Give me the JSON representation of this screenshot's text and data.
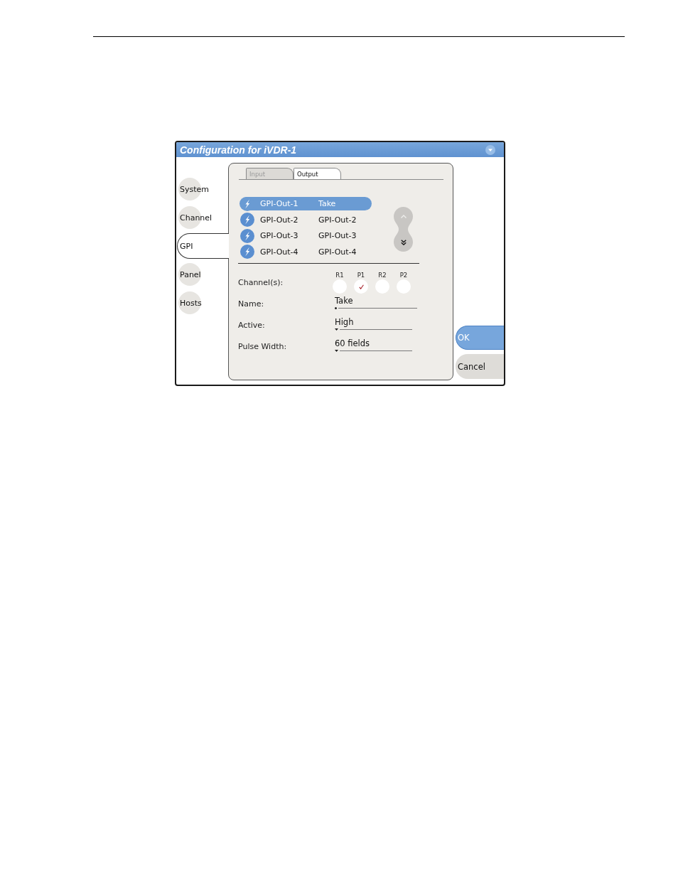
{
  "window": {
    "title": "Configuration for iVDR-1"
  },
  "sidebar": {
    "items": [
      {
        "label": "System",
        "selected": false
      },
      {
        "label": "Channel",
        "selected": false
      },
      {
        "label": "GPI",
        "selected": true
      },
      {
        "label": "Panel",
        "selected": false
      },
      {
        "label": "Hosts",
        "selected": false
      }
    ]
  },
  "tabs": [
    {
      "label": "Input",
      "selected": false
    },
    {
      "label": "Output",
      "selected": true
    }
  ],
  "gpi_outputs": {
    "rows": [
      {
        "port": "GPI-Out-1",
        "name": "Take",
        "selected": true
      },
      {
        "port": "GPI-Out-2",
        "name": "GPI-Out-2",
        "selected": false
      },
      {
        "port": "GPI-Out-3",
        "name": "GPI-Out-3",
        "selected": false
      },
      {
        "port": "GPI-Out-4",
        "name": "GPI-Out-4",
        "selected": false
      }
    ],
    "scroll_buttons": [
      {
        "kind": "up",
        "disabled": true
      },
      {
        "kind": "down",
        "disabled": false
      }
    ]
  },
  "channels": {
    "label": "Channel(s):",
    "options": [
      {
        "label": "R1",
        "checked": false
      },
      {
        "label": "P1",
        "checked": true
      },
      {
        "label": "R2",
        "checked": false
      },
      {
        "label": "P2",
        "checked": false
      }
    ]
  },
  "fields": [
    {
      "kind": "text",
      "label": "Name:",
      "value": "Take"
    },
    {
      "kind": "dropdown",
      "label": "Active:",
      "value": "High"
    },
    {
      "kind": "dropdown",
      "label": "Pulse Width:",
      "value": "60 fields"
    }
  ],
  "buttons": [
    {
      "kind": "confirm",
      "label": "OK"
    },
    {
      "kind": "cancel",
      "label": "Cancel"
    }
  ]
}
